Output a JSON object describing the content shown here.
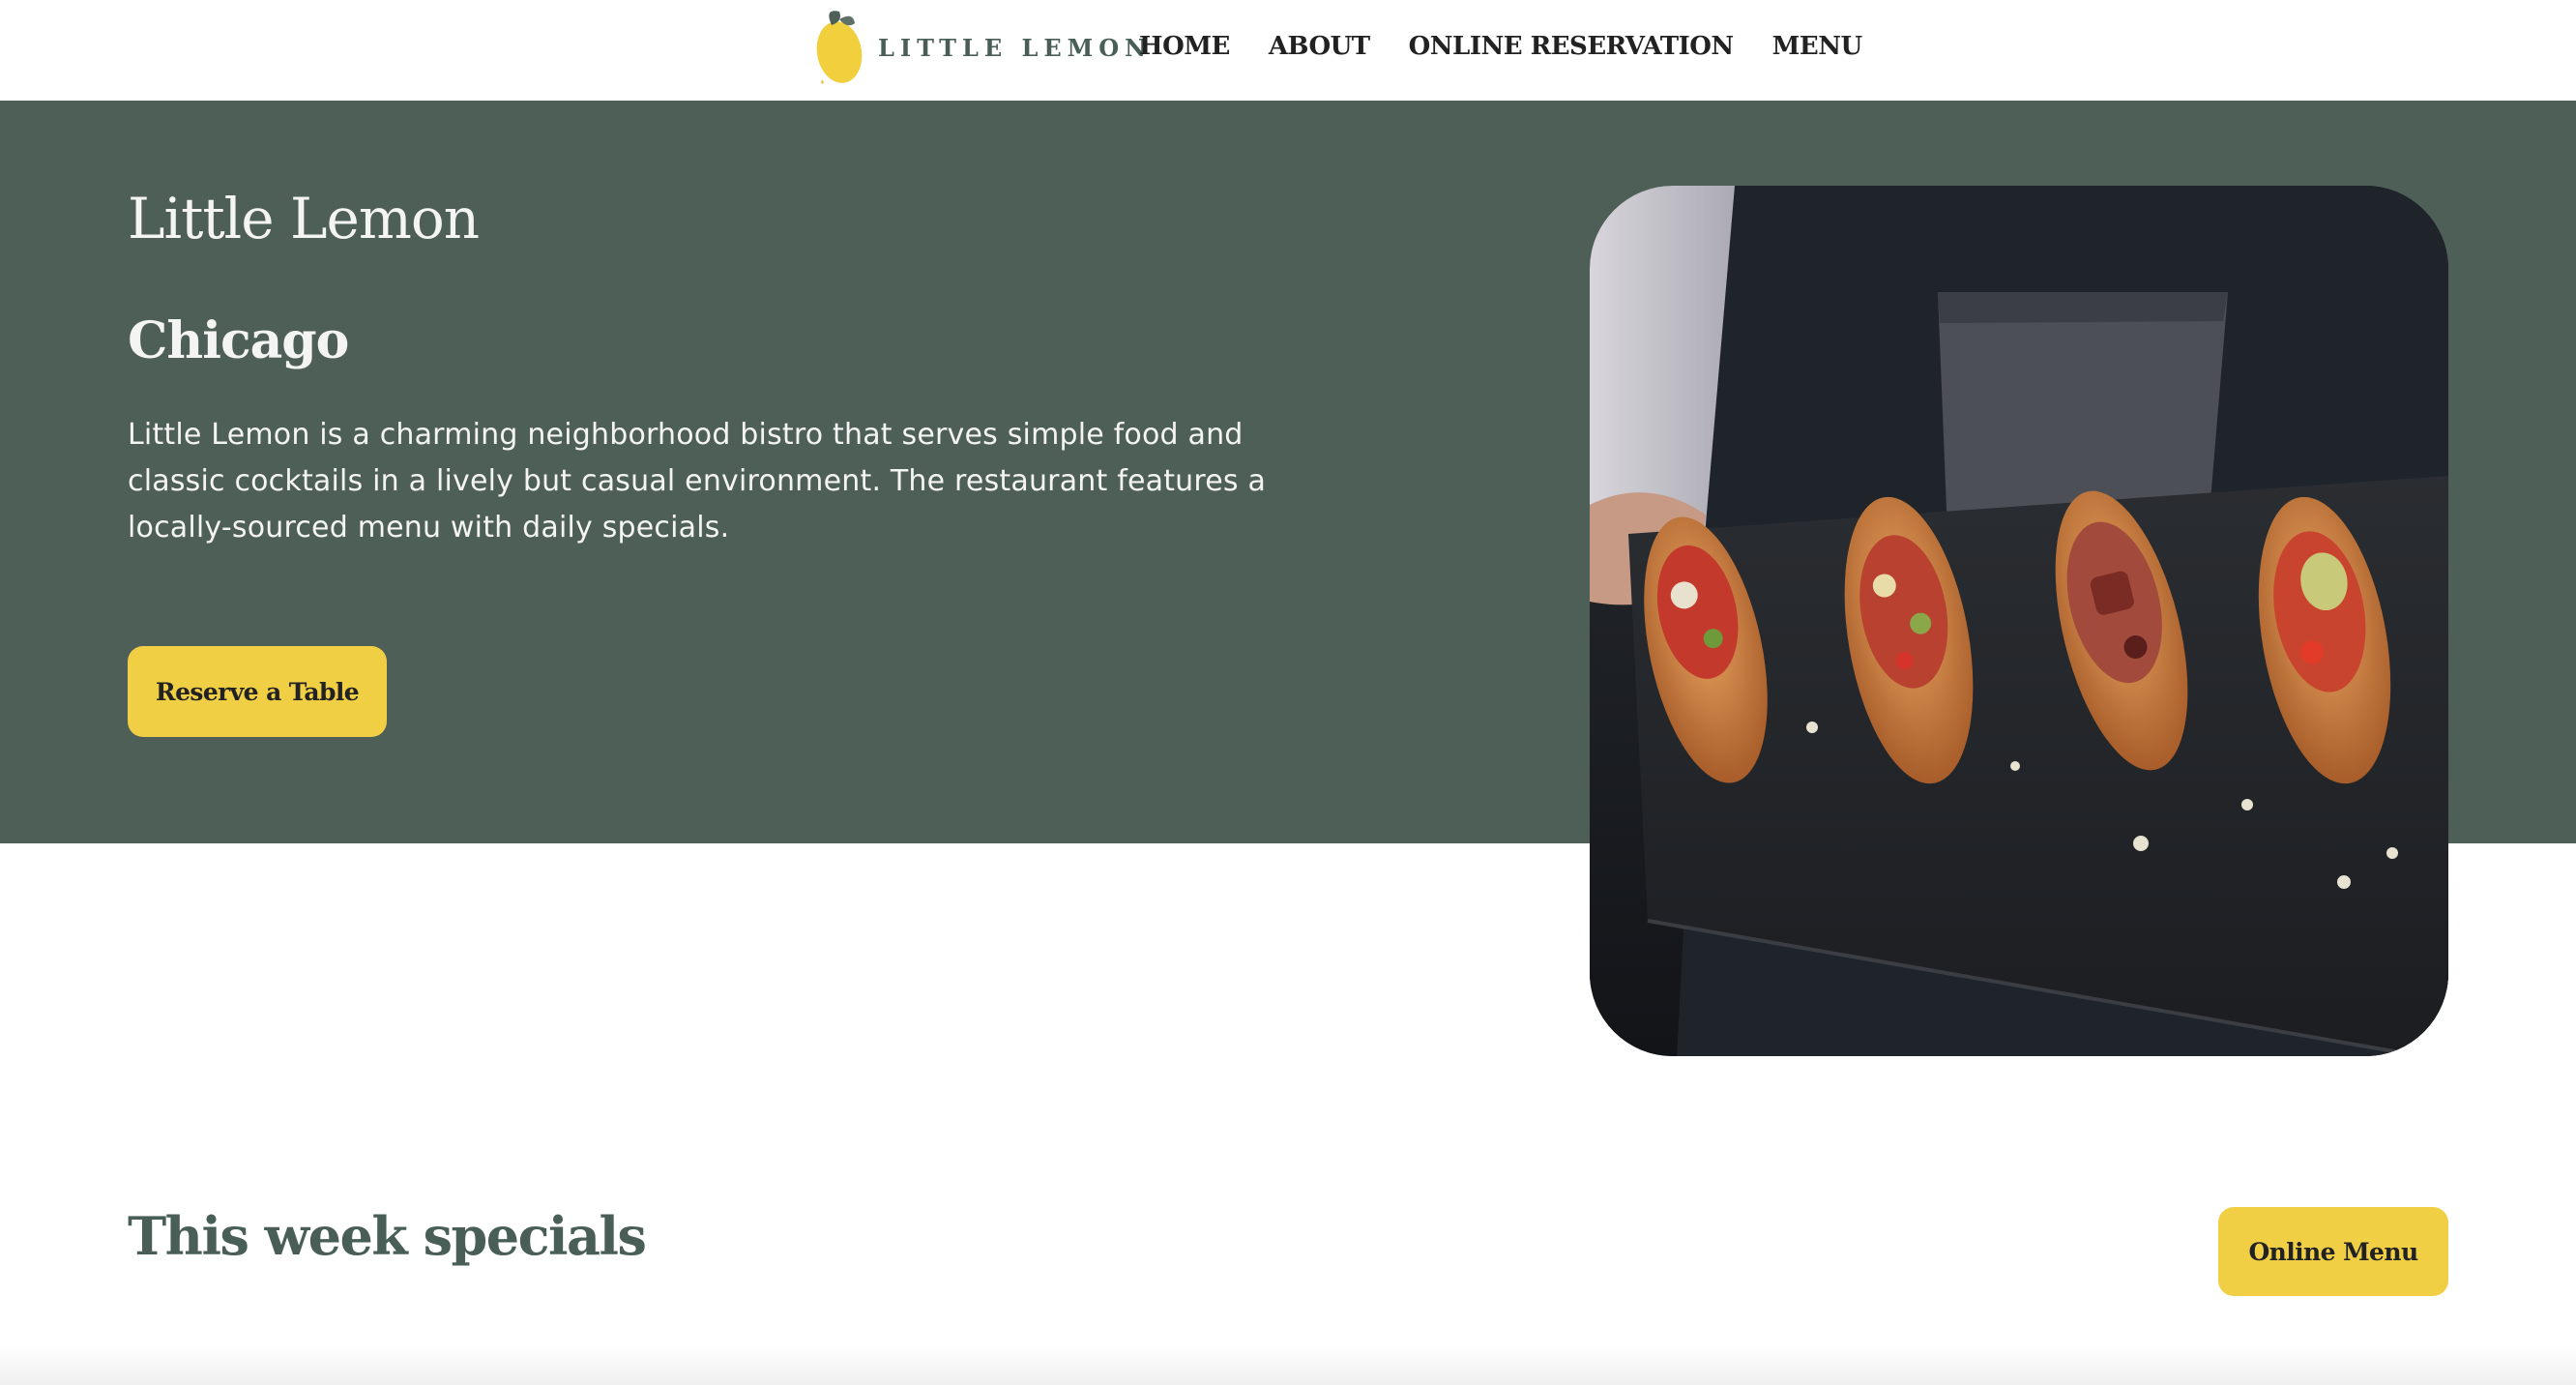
{
  "nav": {
    "logo_text": "LITTLE LEMON",
    "links": [
      "HOME",
      "ABOUT",
      "ONLINE RESERVATION",
      "MENU"
    ]
  },
  "hero": {
    "title": "Little Lemon",
    "subtitle": "Chicago",
    "description": "Little Lemon is a charming neighborhood bistro that serves simple food and classic cocktails in a lively but casual environment. The restaurant features a locally-sourced menu with daily specials.",
    "cta_label": "Reserve a Table",
    "image_icon": "restaurant-food-photo"
  },
  "specials": {
    "title": "This week specials",
    "button_label": "Online Menu"
  },
  "colors": {
    "brand_green": "#495e57",
    "hero_bg": "#4e5f58",
    "brand_yellow": "#f0cf45"
  }
}
